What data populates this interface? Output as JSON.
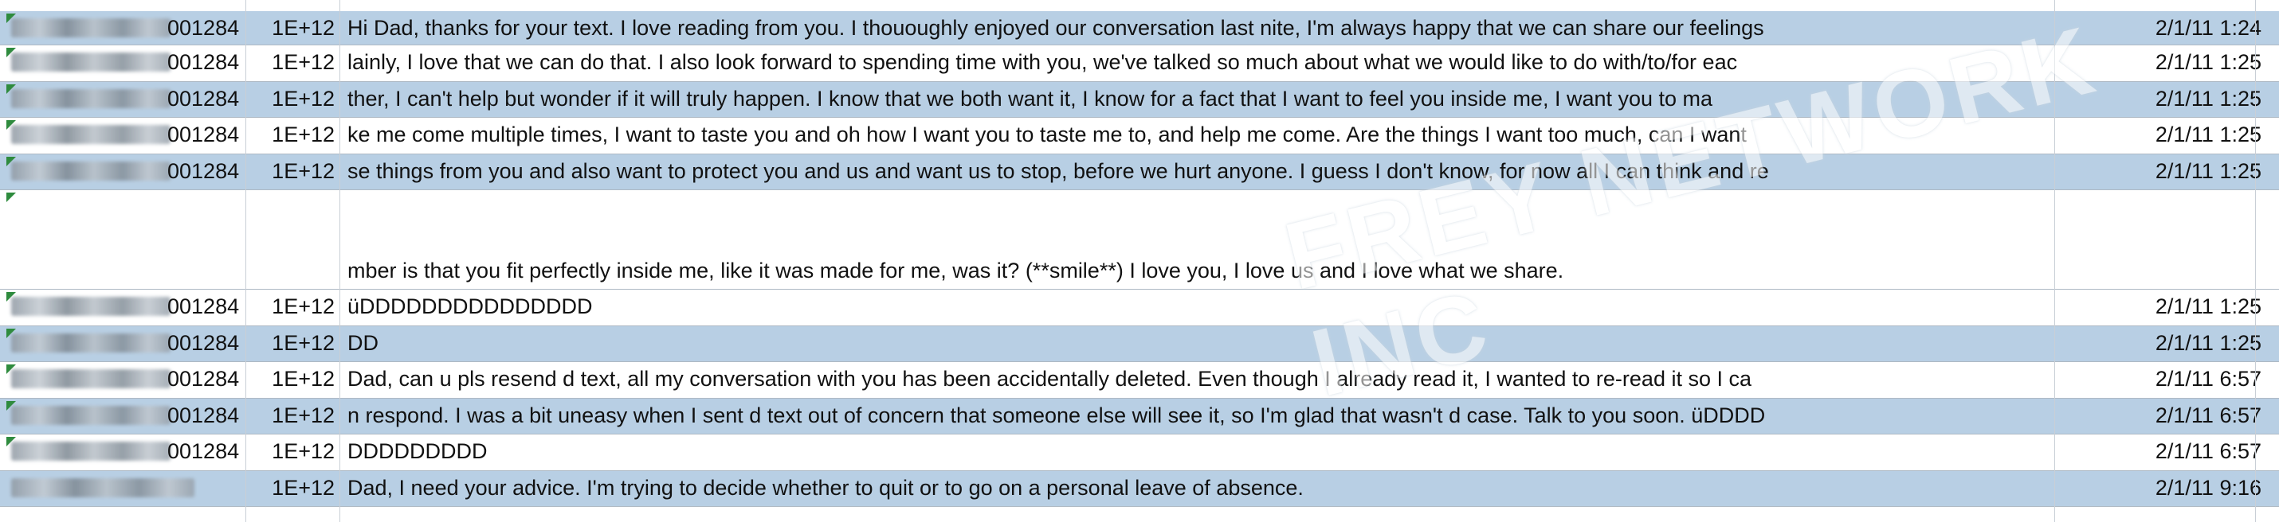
{
  "rows": [
    {
      "id_suffix": "001284",
      "num": "1E+12",
      "msg": "Hi Dad, thanks for your text. I love reading from you. I thououghly enjoyed our conversation last nite, I'm always happy that we can share our feelings",
      "date": "2/1/11 1:24"
    },
    {
      "id_suffix": "001284",
      "num": "1E+12",
      "msg": "lainly, I love that we can do that. I also look forward to spending time with you, we've talked so much about what we would like to do with/to/for eac",
      "date": "2/1/11 1:25"
    },
    {
      "id_suffix": "001284",
      "num": "1E+12",
      "msg": "ther, I can't help but wonder if it will truly happen. I know that we both want it, I know for a fact that I want to feel you inside me, I want you to ma",
      "date": "2/1/11 1:25"
    },
    {
      "id_suffix": "001284",
      "num": "1E+12",
      "msg": "ke me come multiple times, I want to taste you and oh how I want you to taste me to, and help me come. Are the things I want too much, can I want",
      "date": "2/1/11 1:25"
    },
    {
      "id_suffix": "001284",
      "num": "1E+12",
      "msg": "se things from you and also want to protect you and us and want us to stop, before we hurt anyone. I guess I don't know, for now all I can think and re",
      "date": "2/1/11 1:25"
    },
    {
      "id_suffix": "",
      "num": "",
      "msg": "mber is that you fit perfectly inside me, like it was made for me, was it? (**smile**) I love you, I love us and I love what we share.",
      "date": ""
    },
    {
      "id_suffix": "001284",
      "num": "1E+12",
      "msg": "üDDDDDDDDDDDDDDD",
      "date": "2/1/11 1:25"
    },
    {
      "id_suffix": "001284",
      "num": "1E+12",
      "msg": "DD",
      "date": "2/1/11 1:25"
    },
    {
      "id_suffix": "001284",
      "num": "1E+12",
      "msg": "Dad, can u pls resend d text, all my conversation with you has been accidentally deleted.  Even though I already read it, I wanted to re-read it so I ca",
      "date": "2/1/11 6:57"
    },
    {
      "id_suffix": "001284",
      "num": "1E+12",
      "msg": "n respond. I was a bit uneasy when I sent d text out of concern that someone else will see it, so I'm glad that wasn't d case. Talk to you soon. üDDDD",
      "date": "2/1/11 6:57"
    },
    {
      "id_suffix": "001284",
      "num": "1E+12",
      "msg": "DDDDDDDDD",
      "date": "2/1/11 6:57"
    },
    {
      "id_suffix": "",
      "num": "1E+12",
      "msg": "Dad, I need your advice. I'm trying to decide whether to quit or to go on a personal leave of absence.",
      "date": "2/1/11 9:16"
    }
  ],
  "watermark": "FREY NETWORK INC",
  "colors": {
    "row_highlight": "#b8cfe4",
    "grid": "#aeb9c4",
    "tag_green": "#2e8b3d"
  }
}
